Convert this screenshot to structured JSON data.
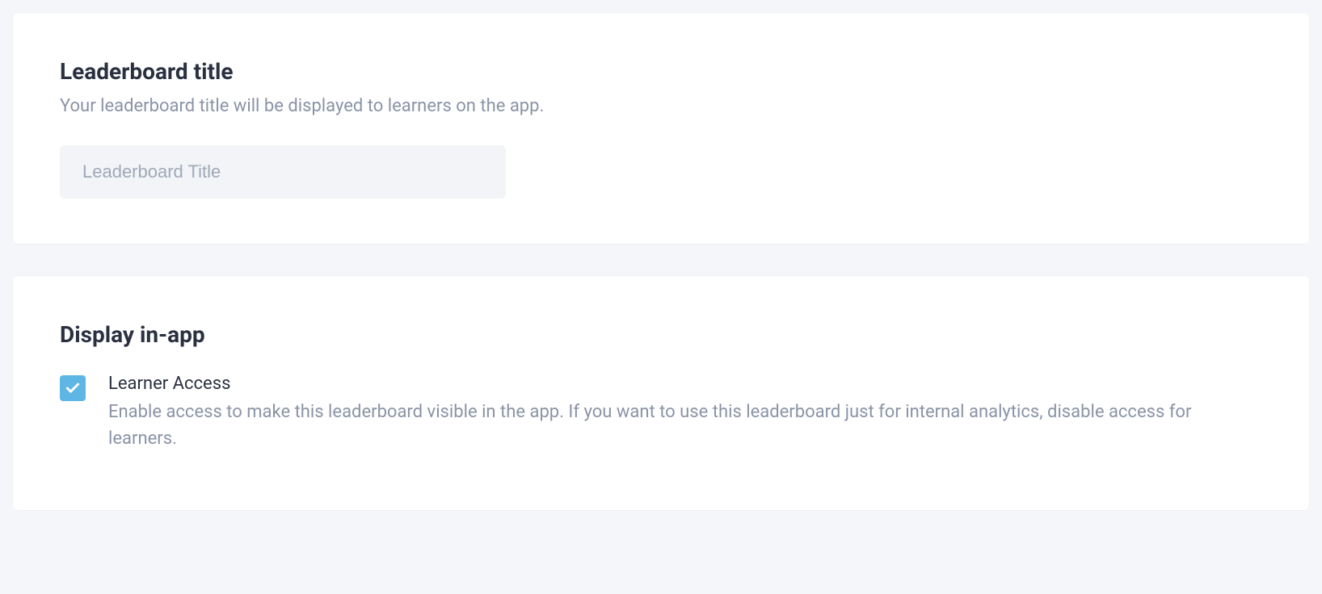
{
  "title_section": {
    "heading": "Leaderboard title",
    "description": "Your leaderboard title will be displayed to learners on the app.",
    "input_placeholder": "Leaderboard Title",
    "input_value": ""
  },
  "display_section": {
    "heading": "Display in-app",
    "checkbox": {
      "checked": true,
      "label": "Learner Access",
      "description": "Enable access to make this leaderboard visible in the app. If you want to use this leaderboard just for internal analytics, disable access for learners."
    }
  }
}
